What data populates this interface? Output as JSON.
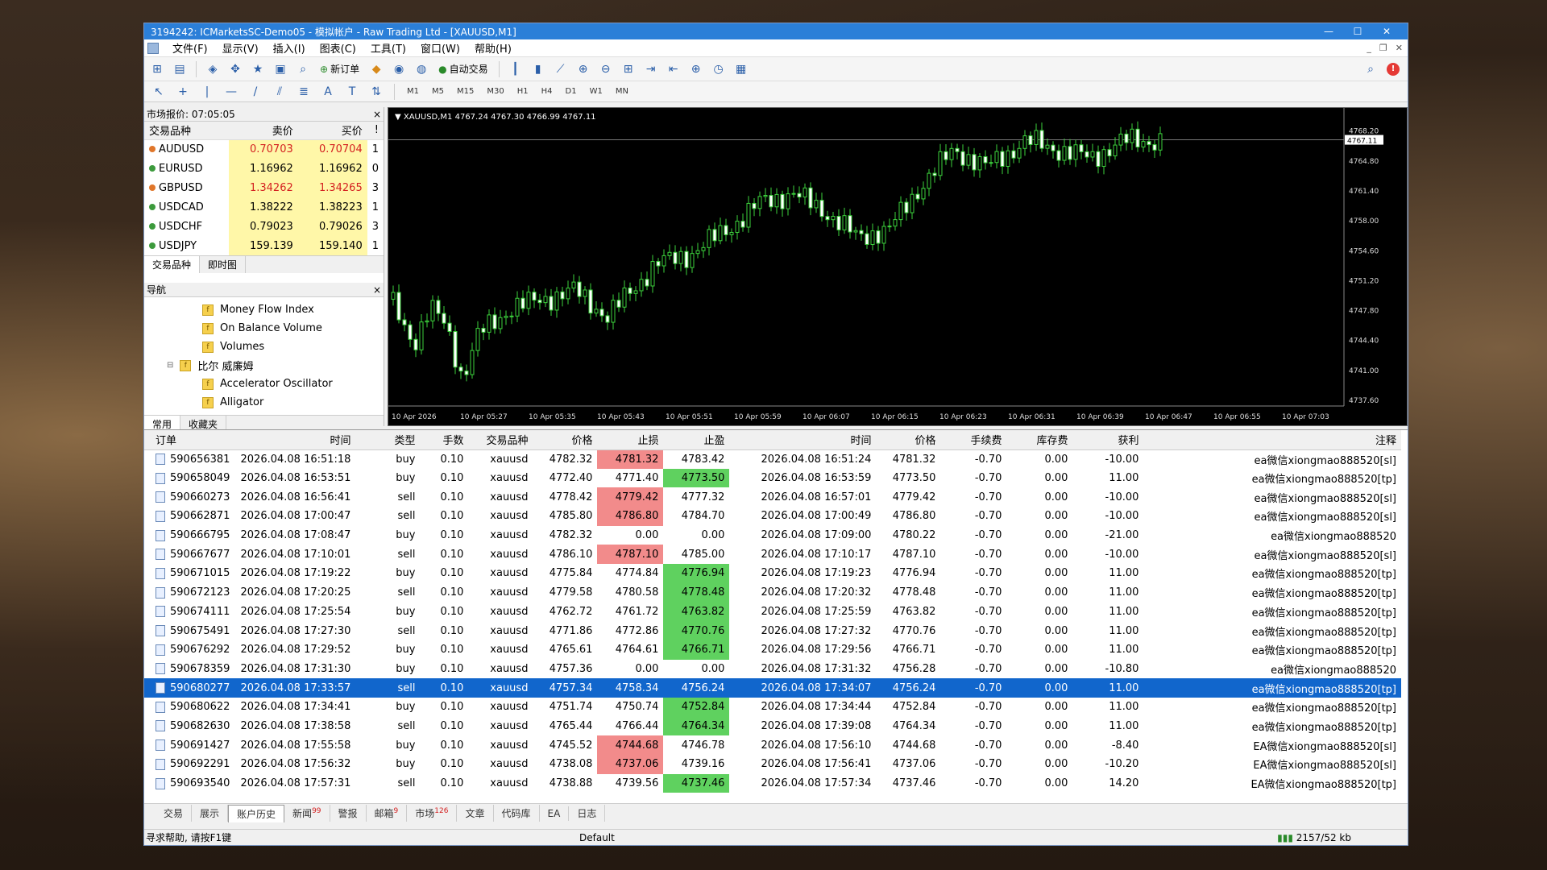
{
  "window": {
    "title": "3194242: ICMarketsSC-Demo05 - 模拟帐户 - Raw Trading Ltd - [XAUUSD,M1]"
  },
  "menu": [
    "文件(F)",
    "显示(V)",
    "插入(I)",
    "图表(C)",
    "工具(T)",
    "窗口(W)",
    "帮助(H)"
  ],
  "toolbar": {
    "new_order": "新订单",
    "auto_trading": "自动交易"
  },
  "timeframes": [
    "M1",
    "M5",
    "M15",
    "M30",
    "H1",
    "H4",
    "D1",
    "W1",
    "MN"
  ],
  "market_watch": {
    "title": "市场报价: 07:05:05",
    "headers": [
      "交易品种",
      "卖价",
      "买价",
      "!"
    ],
    "rows": [
      {
        "symbol": "AUDUSD",
        "bid": "0.70703",
        "ask": "0.70704",
        "n": "1",
        "down": true,
        "dot": "#e0762a"
      },
      {
        "symbol": "EURUSD",
        "bid": "1.16962",
        "ask": "1.16962",
        "n": "0",
        "down": false,
        "dot": "#3c9a3c"
      },
      {
        "symbol": "GBPUSD",
        "bid": "1.34262",
        "ask": "1.34265",
        "n": "3",
        "down": true,
        "dot": "#e0762a"
      },
      {
        "symbol": "USDCAD",
        "bid": "1.38222",
        "ask": "1.38223",
        "n": "1",
        "down": false,
        "dot": "#3c9a3c"
      },
      {
        "symbol": "USDCHF",
        "bid": "0.79023",
        "ask": "0.79026",
        "n": "3",
        "down": false,
        "dot": "#3c9a3c"
      },
      {
        "symbol": "USDJPY",
        "bid": "159.139",
        "ask": "159.140",
        "n": "1",
        "down": false,
        "dot": "#3c9a3c"
      }
    ],
    "tabs": [
      "交易品种",
      "即时图"
    ]
  },
  "navigator": {
    "title": "导航",
    "items": [
      {
        "label": "Money Flow Index",
        "group": false
      },
      {
        "label": "On Balance Volume",
        "group": false
      },
      {
        "label": "Volumes",
        "group": false
      },
      {
        "label": "比尔 威廉姆",
        "group": true
      },
      {
        "label": "Accelerator Oscillator",
        "group": false
      },
      {
        "label": "Alligator",
        "group": false
      }
    ],
    "tabs": [
      "常用",
      "收藏夹"
    ]
  },
  "chart": {
    "label": "▼ XAUUSD,M1  4767.24 4767.30 4766.99 4767.11",
    "price_ticks": [
      "4768.20",
      "4764.80",
      "4761.40",
      "4758.00",
      "4754.60",
      "4751.20",
      "4747.80",
      "4744.40",
      "4741.00",
      "4737.60"
    ],
    "current_price": "4767.11",
    "time_ticks": [
      "10 Apr 2026",
      "10 Apr 05:27",
      "10 Apr 05:35",
      "10 Apr 05:43",
      "10 Apr 05:51",
      "10 Apr 05:59",
      "10 Apr 06:07",
      "10 Apr 06:15",
      "10 Apr 06:23",
      "10 Apr 06:31",
      "10 Apr 06:39",
      "10 Apr 06:47",
      "10 Apr 06:55",
      "10 Apr 07:03"
    ]
  },
  "orders": {
    "headers": [
      "订单",
      "时间",
      "类型",
      "手数",
      "交易品种",
      "价格",
      "止损",
      "止盈",
      "时间",
      "价格",
      "手续费",
      "库存费",
      "获利",
      "注释"
    ],
    "rows": [
      {
        "id": "590656381",
        "open_time": "2026.04.08 16:51:18",
        "type": "buy",
        "lots": "0.10",
        "symbol": "xauusd",
        "price": "4782.32",
        "sl": "4781.32",
        "tp": "4783.42",
        "close_time": "2026.04.08 16:51:24",
        "close_price": "4781.32",
        "commission": "-0.70",
        "swap": "0.00",
        "profit": "-10.00",
        "comment": "ea微信xiongmao888520[sl]",
        "hl": "sl",
        "sel": false
      },
      {
        "id": "590658049",
        "open_time": "2026.04.08 16:53:51",
        "type": "buy",
        "lots": "0.10",
        "symbol": "xauusd",
        "price": "4772.40",
        "sl": "4771.40",
        "tp": "4773.50",
        "close_time": "2026.04.08 16:53:59",
        "close_price": "4773.50",
        "commission": "-0.70",
        "swap": "0.00",
        "profit": "11.00",
        "comment": "ea微信xiongmao888520[tp]",
        "hl": "tp",
        "sel": false
      },
      {
        "id": "590660273",
        "open_time": "2026.04.08 16:56:41",
        "type": "sell",
        "lots": "0.10",
        "symbol": "xauusd",
        "price": "4778.42",
        "sl": "4779.42",
        "tp": "4777.32",
        "close_time": "2026.04.08 16:57:01",
        "close_price": "4779.42",
        "commission": "-0.70",
        "swap": "0.00",
        "profit": "-10.00",
        "comment": "ea微信xiongmao888520[sl]",
        "hl": "sl",
        "sel": false
      },
      {
        "id": "590662871",
        "open_time": "2026.04.08 17:00:47",
        "type": "sell",
        "lots": "0.10",
        "symbol": "xauusd",
        "price": "4785.80",
        "sl": "4786.80",
        "tp": "4784.70",
        "close_time": "2026.04.08 17:00:49",
        "close_price": "4786.80",
        "commission": "-0.70",
        "swap": "0.00",
        "profit": "-10.00",
        "comment": "ea微信xiongmao888520[sl]",
        "hl": "sl",
        "sel": false
      },
      {
        "id": "590666795",
        "open_time": "2026.04.08 17:08:47",
        "type": "buy",
        "lots": "0.10",
        "symbol": "xauusd",
        "price": "4782.32",
        "sl": "0.00",
        "tp": "0.00",
        "close_time": "2026.04.08 17:09:00",
        "close_price": "4780.22",
        "commission": "-0.70",
        "swap": "0.00",
        "profit": "-21.00",
        "comment": "ea微信xiongmao888520",
        "hl": "",
        "sel": false
      },
      {
        "id": "590667677",
        "open_time": "2026.04.08 17:10:01",
        "type": "sell",
        "lots": "0.10",
        "symbol": "xauusd",
        "price": "4786.10",
        "sl": "4787.10",
        "tp": "4785.00",
        "close_time": "2026.04.08 17:10:17",
        "close_price": "4787.10",
        "commission": "-0.70",
        "swap": "0.00",
        "profit": "-10.00",
        "comment": "ea微信xiongmao888520[sl]",
        "hl": "sl",
        "sel": false
      },
      {
        "id": "590671015",
        "open_time": "2026.04.08 17:19:22",
        "type": "buy",
        "lots": "0.10",
        "symbol": "xauusd",
        "price": "4775.84",
        "sl": "4774.84",
        "tp": "4776.94",
        "close_time": "2026.04.08 17:19:23",
        "close_price": "4776.94",
        "commission": "-0.70",
        "swap": "0.00",
        "profit": "11.00",
        "comment": "ea微信xiongmao888520[tp]",
        "hl": "tp",
        "sel": false
      },
      {
        "id": "590672123",
        "open_time": "2026.04.08 17:20:25",
        "type": "sell",
        "lots": "0.10",
        "symbol": "xauusd",
        "price": "4779.58",
        "sl": "4780.58",
        "tp": "4778.48",
        "close_time": "2026.04.08 17:20:32",
        "close_price": "4778.48",
        "commission": "-0.70",
        "swap": "0.00",
        "profit": "11.00",
        "comment": "ea微信xiongmao888520[tp]",
        "hl": "tp",
        "sel": false
      },
      {
        "id": "590674111",
        "open_time": "2026.04.08 17:25:54",
        "type": "buy",
        "lots": "0.10",
        "symbol": "xauusd",
        "price": "4762.72",
        "sl": "4761.72",
        "tp": "4763.82",
        "close_time": "2026.04.08 17:25:59",
        "close_price": "4763.82",
        "commission": "-0.70",
        "swap": "0.00",
        "profit": "11.00",
        "comment": "ea微信xiongmao888520[tp]",
        "hl": "tp",
        "sel": false
      },
      {
        "id": "590675491",
        "open_time": "2026.04.08 17:27:30",
        "type": "sell",
        "lots": "0.10",
        "symbol": "xauusd",
        "price": "4771.86",
        "sl": "4772.86",
        "tp": "4770.76",
        "close_time": "2026.04.08 17:27:32",
        "close_price": "4770.76",
        "commission": "-0.70",
        "swap": "0.00",
        "profit": "11.00",
        "comment": "ea微信xiongmao888520[tp]",
        "hl": "tp",
        "sel": false
      },
      {
        "id": "590676292",
        "open_time": "2026.04.08 17:29:52",
        "type": "buy",
        "lots": "0.10",
        "symbol": "xauusd",
        "price": "4765.61",
        "sl": "4764.61",
        "tp": "4766.71",
        "close_time": "2026.04.08 17:29:56",
        "close_price": "4766.71",
        "commission": "-0.70",
        "swap": "0.00",
        "profit": "11.00",
        "comment": "ea微信xiongmao888520[tp]",
        "hl": "tp",
        "sel": false
      },
      {
        "id": "590678359",
        "open_time": "2026.04.08 17:31:30",
        "type": "buy",
        "lots": "0.10",
        "symbol": "xauusd",
        "price": "4757.36",
        "sl": "0.00",
        "tp": "0.00",
        "close_time": "2026.04.08 17:31:32",
        "close_price": "4756.28",
        "commission": "-0.70",
        "swap": "0.00",
        "profit": "-10.80",
        "comment": "ea微信xiongmao888520",
        "hl": "",
        "sel": false
      },
      {
        "id": "590680277",
        "open_time": "2026.04.08 17:33:57",
        "type": "sell",
        "lots": "0.10",
        "symbol": "xauusd",
        "price": "4757.34",
        "sl": "4758.34",
        "tp": "4756.24",
        "close_time": "2026.04.08 17:34:07",
        "close_price": "4756.24",
        "commission": "-0.70",
        "swap": "0.00",
        "profit": "11.00",
        "comment": "ea微信xiongmao888520[tp]",
        "hl": "tp",
        "sel": true
      },
      {
        "id": "590680622",
        "open_time": "2026.04.08 17:34:41",
        "type": "buy",
        "lots": "0.10",
        "symbol": "xauusd",
        "price": "4751.74",
        "sl": "4750.74",
        "tp": "4752.84",
        "close_time": "2026.04.08 17:34:44",
        "close_price": "4752.84",
        "commission": "-0.70",
        "swap": "0.00",
        "profit": "11.00",
        "comment": "ea微信xiongmao888520[tp]",
        "hl": "tp",
        "sel": false
      },
      {
        "id": "590682630",
        "open_time": "2026.04.08 17:38:58",
        "type": "sell",
        "lots": "0.10",
        "symbol": "xauusd",
        "price": "4765.44",
        "sl": "4766.44",
        "tp": "4764.34",
        "close_time": "2026.04.08 17:39:08",
        "close_price": "4764.34",
        "commission": "-0.70",
        "swap": "0.00",
        "profit": "11.00",
        "comment": "ea微信xiongmao888520[tp]",
        "hl": "tp",
        "sel": false
      },
      {
        "id": "590691427",
        "open_time": "2026.04.08 17:55:58",
        "type": "buy",
        "lots": "0.10",
        "symbol": "xauusd",
        "price": "4745.52",
        "sl": "4744.68",
        "tp": "4746.78",
        "close_time": "2026.04.08 17:56:10",
        "close_price": "4744.68",
        "commission": "-0.70",
        "swap": "0.00",
        "profit": "-8.40",
        "comment": "EA微信xiongmao888520[sl]",
        "hl": "sl",
        "sel": false
      },
      {
        "id": "590692291",
        "open_time": "2026.04.08 17:56:32",
        "type": "buy",
        "lots": "0.10",
        "symbol": "xauusd",
        "price": "4738.08",
        "sl": "4737.06",
        "tp": "4739.16",
        "close_time": "2026.04.08 17:56:41",
        "close_price": "4737.06",
        "commission": "-0.70",
        "swap": "0.00",
        "profit": "-10.20",
        "comment": "EA微信xiongmao888520[sl]",
        "hl": "sl",
        "sel": false
      },
      {
        "id": "590693540",
        "open_time": "2026.04.08 17:57:31",
        "type": "sell",
        "lots": "0.10",
        "symbol": "xauusd",
        "price": "4738.88",
        "sl": "4739.56",
        "tp": "4737.46",
        "close_time": "2026.04.08 17:57:34",
        "close_price": "4737.46",
        "commission": "-0.70",
        "swap": "0.00",
        "profit": "14.20",
        "comment": "EA微信xiongmao888520[tp]",
        "hl": "tp",
        "sel": false
      }
    ]
  },
  "bottom_tabs": [
    {
      "label": "交易",
      "badge": ""
    },
    {
      "label": "展示",
      "badge": ""
    },
    {
      "label": "账户历史",
      "badge": "",
      "active": true
    },
    {
      "label": "新闻",
      "badge": "99"
    },
    {
      "label": "警报",
      "badge": ""
    },
    {
      "label": "邮箱",
      "badge": "9"
    },
    {
      "label": "市场",
      "badge": "126"
    },
    {
      "label": "文章",
      "badge": ""
    },
    {
      "label": "代码库",
      "badge": ""
    },
    {
      "label": "EA",
      "badge": ""
    },
    {
      "label": "日志",
      "badge": ""
    }
  ],
  "status": {
    "help": "寻求帮助, 请按F1键",
    "profile": "Default",
    "traffic": "2157/52 kb"
  },
  "colors": {
    "sl_highlight": "#f28b8b",
    "tp_highlight": "#5fd15f",
    "selected_row": "#1166cc",
    "bull_candle": "#3cd23c"
  }
}
